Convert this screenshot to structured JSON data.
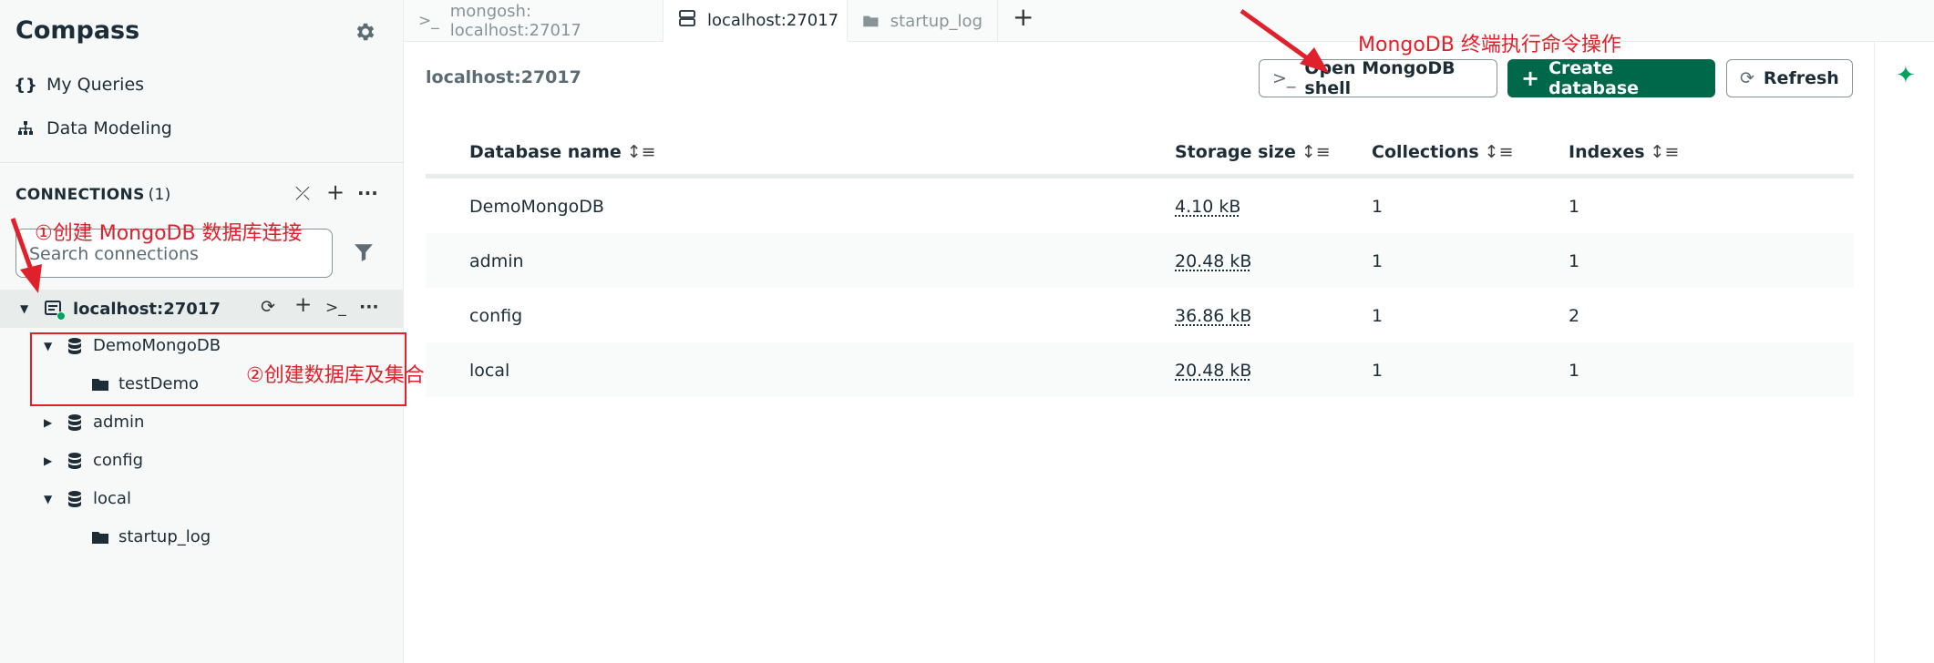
{
  "app": {
    "title": "Compass"
  },
  "sidebar": {
    "nav": [
      {
        "icon": "{}",
        "label": "My Queries"
      },
      {
        "icon": "sitemap-icon",
        "label": "Data Modeling"
      }
    ],
    "connections_header": "CONNECTIONS",
    "connections_count": "(1)",
    "search_placeholder": "Search connections",
    "connection": {
      "label": "localhost:27017",
      "status_color": "#00a35c"
    },
    "tree": [
      {
        "name": "DemoMongoDB",
        "expanded": true,
        "collections": [
          "testDemo"
        ]
      },
      {
        "name": "admin",
        "expanded": false,
        "collections": []
      },
      {
        "name": "config",
        "expanded": false,
        "collections": []
      },
      {
        "name": "local",
        "expanded": true,
        "collections": [
          "startup_log"
        ]
      }
    ]
  },
  "tabs": [
    {
      "icon": ">_",
      "label": "mongosh: localhost:27017",
      "active": false
    },
    {
      "icon": "server-icon",
      "label": "localhost:27017",
      "active": true
    },
    {
      "icon": "folder-icon",
      "label": "startup_log",
      "active": false
    }
  ],
  "main": {
    "breadcrumb": "localhost:27017",
    "buttons": {
      "open_shell": "Open MongoDB shell",
      "create_database": "Create database",
      "refresh": "Refresh"
    },
    "table": {
      "headers": [
        "Database name",
        "Storage size",
        "Collections",
        "Indexes"
      ],
      "rows": [
        [
          "DemoMongoDB",
          "4.10 kB",
          "1",
          "1"
        ],
        [
          "admin",
          "20.48 kB",
          "1",
          "1"
        ],
        [
          "config",
          "36.86 kB",
          "1",
          "2"
        ],
        [
          "local",
          "20.48 kB",
          "1",
          "1"
        ]
      ]
    }
  },
  "annotations": {
    "shell_note": "MongoDB 终端执行命令操作",
    "step1": "①创建 MongoDB 数据库连接",
    "step2": "②创建数据库及集合"
  },
  "colors": {
    "brand_green": "#00684a",
    "annotation_red": "#e0202a",
    "sidebar_bg": "#f7f8f8"
  }
}
